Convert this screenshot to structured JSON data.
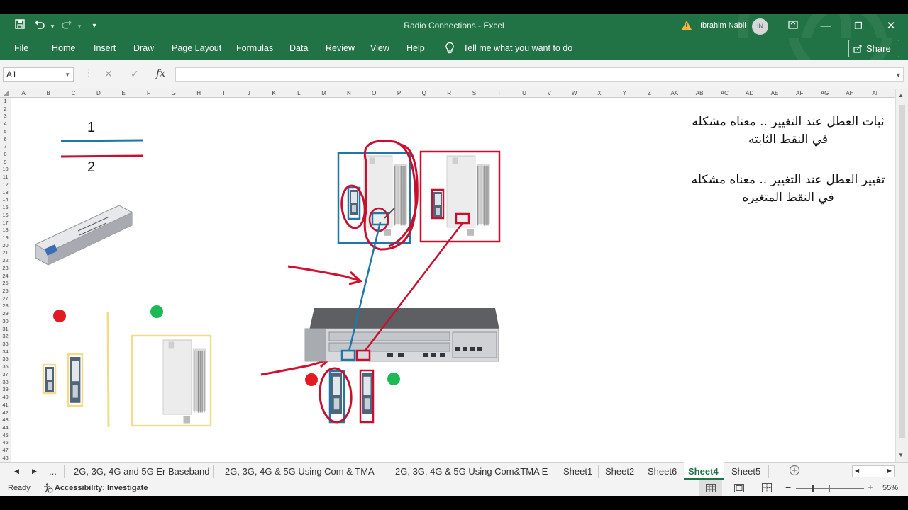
{
  "window": {
    "title": "Radio Connections  -  Excel",
    "user_name": "Ibrahim Nabil",
    "user_initials": "IN",
    "qat": {
      "save_icon": "save-icon",
      "undo_icon": "undo-icon",
      "redo_icon": "redo-icon",
      "customize_icon": "chevron-down-icon"
    },
    "controls": {
      "minimize": "—",
      "restore": "❐",
      "close": "✕"
    }
  },
  "ribbon": {
    "tabs": [
      "File",
      "Home",
      "Insert",
      "Draw",
      "Page Layout",
      "Formulas",
      "Data",
      "Review",
      "View",
      "Help"
    ],
    "tell_me": "Tell me what you want to do",
    "share": "Share"
  },
  "formula_bar": {
    "name_box": "A1",
    "cancel": "✕",
    "enter": "✓",
    "fx": "fx",
    "value": ""
  },
  "grid": {
    "columns": [
      "A",
      "B",
      "C",
      "D",
      "E",
      "F",
      "G",
      "H",
      "I",
      "J",
      "K",
      "L",
      "M",
      "N",
      "O",
      "P",
      "Q",
      "R",
      "S",
      "T",
      "U",
      "V",
      "W",
      "X",
      "Y",
      "Z",
      "AA",
      "AB",
      "AC",
      "AD",
      "AE",
      "AF",
      "AG",
      "AH",
      "AI"
    ],
    "rows": [
      "1",
      "2",
      "3",
      "4",
      "5",
      "6",
      "7",
      "8",
      "9",
      "10",
      "11",
      "12",
      "13",
      "14",
      "15",
      "16",
      "17",
      "18",
      "19",
      "20",
      "21",
      "22",
      "23",
      "24",
      "25",
      "26",
      "27",
      "28",
      "29",
      "30",
      "31",
      "32",
      "33",
      "34",
      "35",
      "36",
      "37",
      "38",
      "39",
      "40",
      "41",
      "42",
      "43",
      "44",
      "45",
      "46",
      "47",
      "48"
    ]
  },
  "drawing": {
    "label_1": "1",
    "label_2": "2",
    "note_fixed_line1": "ثبات العطل عند التغيير .. معناه مشكله",
    "note_fixed_line2": "في النقط الثابته",
    "note_change_line1": "تغيير العطل عند التغيير .. معناه مشكله",
    "note_change_line2": "في النقط المتغيره",
    "colors": {
      "blue": "#1f77a8",
      "red": "#c8102e",
      "green": "#1db954",
      "yellow": "#f2dc8a",
      "excel_green": "#217346"
    },
    "objects": [
      "sfp-module",
      "radio-unit",
      "baseband-chassis",
      "red-status-dot",
      "green-status-dot"
    ]
  },
  "sheets": {
    "nav_prev": "◀",
    "nav_next": "▶",
    "more": "...",
    "tabs": [
      "2G, 3G, 4G and 5G Er Baseband",
      "2G, 3G, 4G & 5G Using Com & TMA",
      "2G, 3G, 4G & 5G Using Com&TMA E",
      "Sheet1",
      "Sheet2",
      "Sheet6",
      "Sheet4",
      "Sheet5"
    ],
    "active": "Sheet4",
    "add": "+"
  },
  "status": {
    "ready": "Ready",
    "accessibility": "Accessibility: Investigate",
    "zoom_out": "−",
    "zoom_in": "+",
    "zoom": "55%",
    "zoom_level": 0.55
  }
}
